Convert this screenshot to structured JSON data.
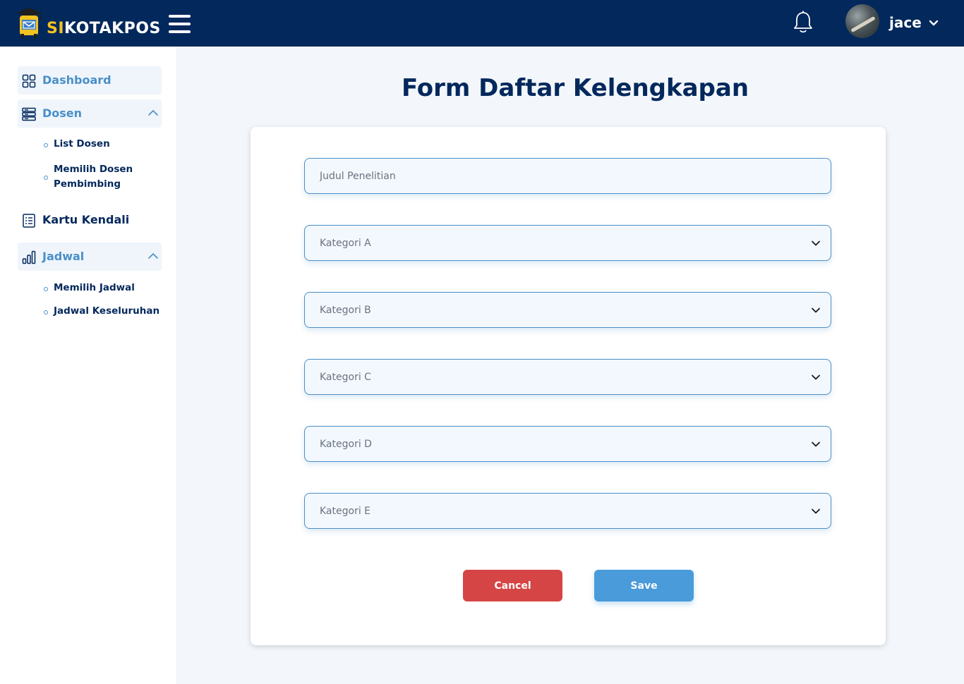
{
  "header": {
    "brand_accent": "SI",
    "brand_rest": "KOTAKPOS",
    "username": "jace",
    "icons": [
      "logo-icon",
      "hamburger-icon",
      "bell-icon",
      "avatar",
      "chevron-down-icon"
    ]
  },
  "sidebar": {
    "items": [
      {
        "label": "Dashboard",
        "icon": "dashboard-grid-icon",
        "active": true
      },
      {
        "label": "Dosen",
        "icon": "server-icon",
        "active": true,
        "expanded": true,
        "children": [
          {
            "label": "List Dosen"
          },
          {
            "label": "Memilih Dosen Pembimbing"
          }
        ]
      },
      {
        "label": "Kartu Kendali",
        "icon": "list-document-icon",
        "active": false
      },
      {
        "label": "Jadwal",
        "icon": "bar-chart-icon",
        "active": true,
        "expanded": true,
        "children": [
          {
            "label": "Memilih Jadwal"
          },
          {
            "label": "Jadwal Keseluruhan"
          }
        ]
      }
    ]
  },
  "main": {
    "title": "Form Daftar Kelengkapan",
    "form": {
      "judul_placeholder": "Judul Penelitian",
      "selects": [
        {
          "placeholder": "Kategori A"
        },
        {
          "placeholder": "Kategori B"
        },
        {
          "placeholder": "Kategori C"
        },
        {
          "placeholder": "Kategori D"
        },
        {
          "placeholder": "Kategori E"
        }
      ]
    },
    "buttons": {
      "cancel": "Cancel",
      "save": "Save"
    }
  },
  "colors": {
    "navy": "#03285c",
    "accent_yellow": "#f3c321",
    "blue": "#4a8fc8",
    "cancel_red": "#d64545",
    "save_blue": "#4a9bda",
    "background": "#f3f7fc"
  }
}
